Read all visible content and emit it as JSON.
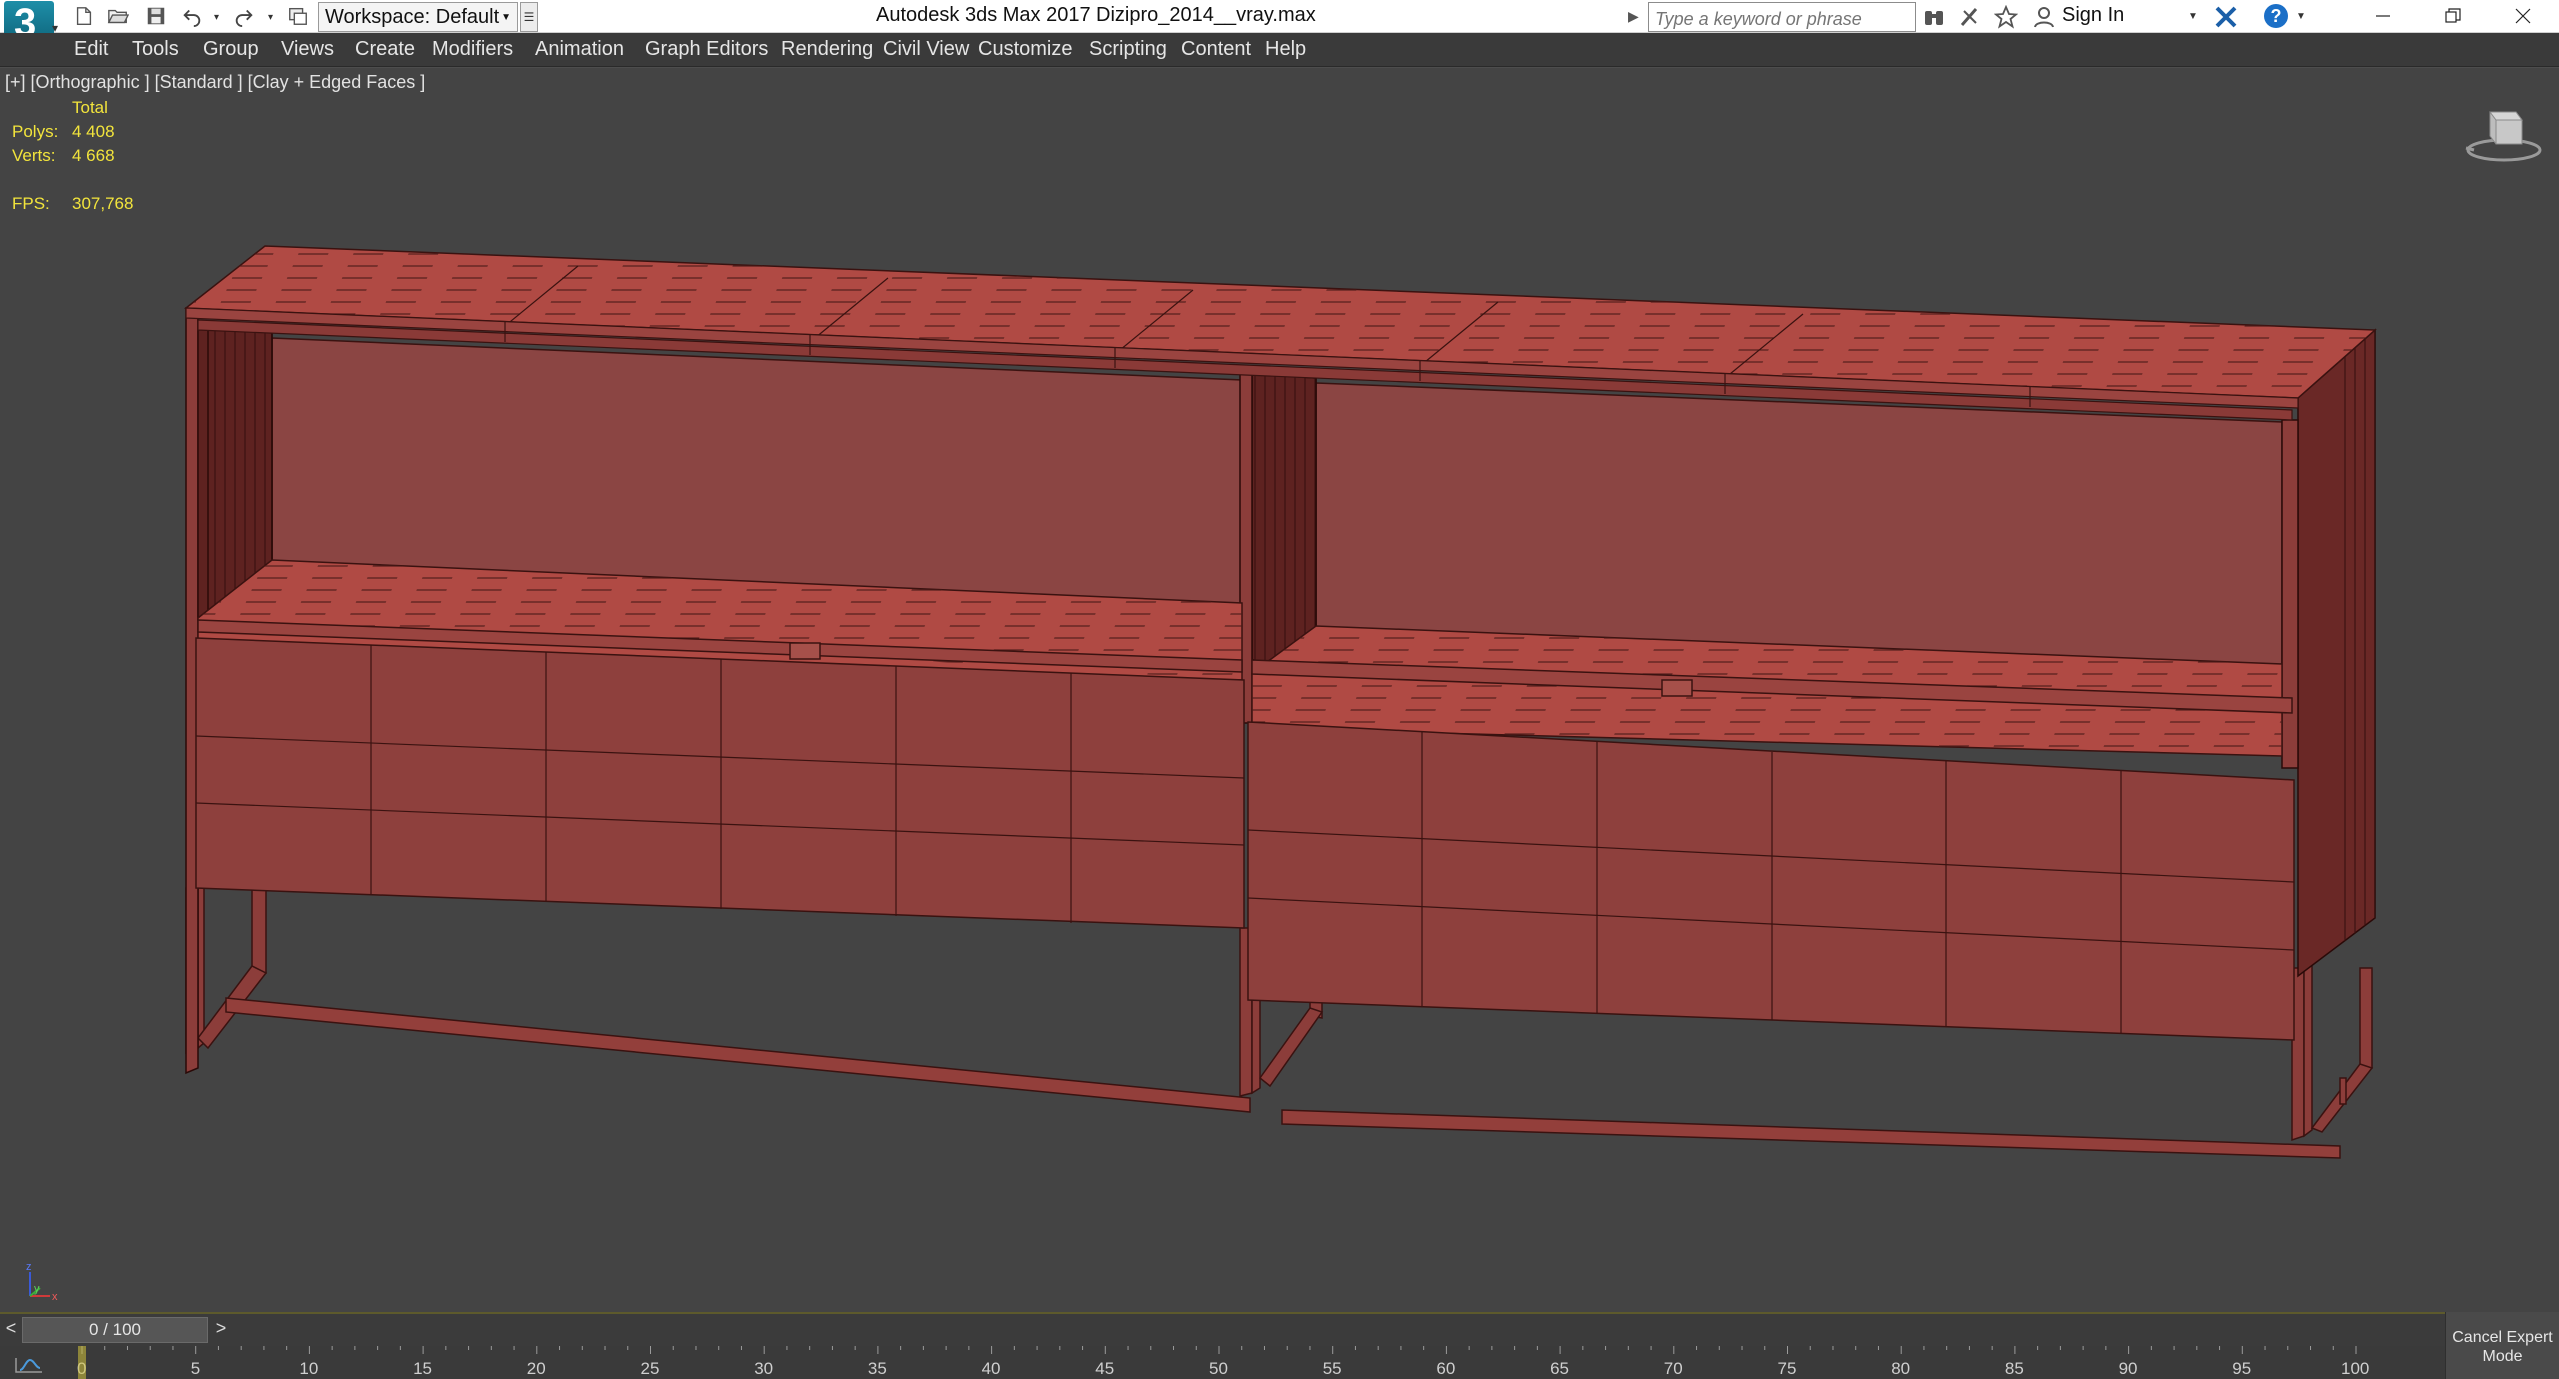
{
  "titlebar": {
    "app_title": "Autodesk 3ds Max 2017",
    "file_title": "Dizipro_2014__vray.max",
    "workspace_label": "Workspace: Default",
    "search_placeholder": "Type a keyword or phrase",
    "signin_label": "Sign In",
    "logo_text": "3",
    "icons": [
      "new-file-icon",
      "open-file-icon",
      "save-icon",
      "undo-icon",
      "redo-icon",
      "project-icon",
      "binoculars-icon",
      "communication-center-icon",
      "favorites-icon",
      "user-icon",
      "exchange-icon",
      "help-icon",
      "minimize-icon",
      "restore-icon",
      "close-icon"
    ]
  },
  "menu": {
    "items": [
      "Edit",
      "Tools",
      "Group",
      "Views",
      "Create",
      "Modifiers",
      "Animation",
      "Graph Editors",
      "Rendering",
      "Civil View",
      "Customize",
      "Scripting",
      "Content",
      "Help"
    ]
  },
  "viewport": {
    "label": "[+] [Orthographic ] [Standard ] [Clay + Edged Faces ]",
    "stats": {
      "header": "Total",
      "polys_label": "Polys:",
      "polys_value": "4 408",
      "verts_label": "Verts:",
      "verts_value": "4 668",
      "fps_label": "FPS:",
      "fps_value": "307,768"
    },
    "object_color": "#8e403d",
    "background_color": "#444444",
    "stats_color": "#f2e43c"
  },
  "timeline": {
    "frame_display": "0 / 100",
    "prev_label": "<",
    "next_label": ">",
    "current_frame": 0,
    "start": 0,
    "end": 100,
    "ticks": [
      "0",
      "5",
      "10",
      "15",
      "20",
      "25",
      "30",
      "35",
      "40",
      "45",
      "50",
      "55",
      "60",
      "65",
      "70",
      "75",
      "80",
      "85",
      "90",
      "95",
      "100"
    ]
  },
  "status": {
    "cancel_expert_mode": "Cancel Expert Mode"
  }
}
